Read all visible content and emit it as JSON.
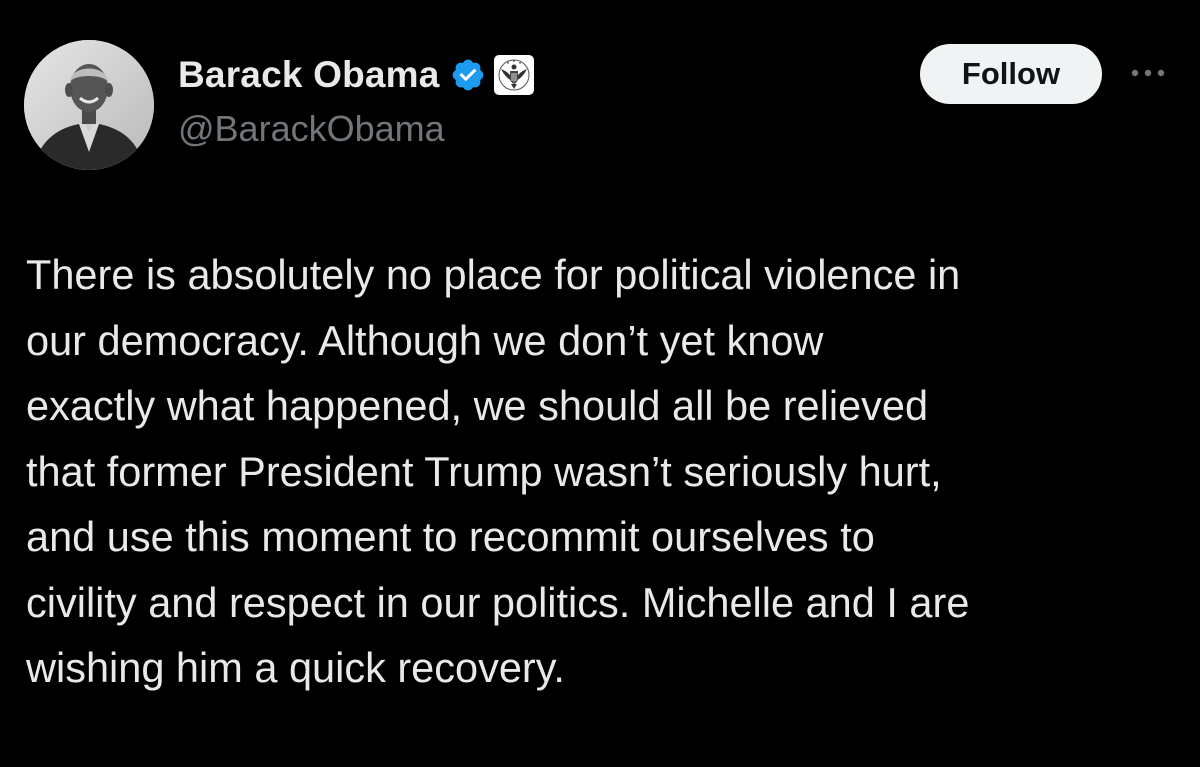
{
  "author": {
    "display_name": "Barack Obama",
    "handle": "@BarackObama",
    "verified_icon": "verified-badge-icon",
    "affiliation_icon": "government-seal-icon",
    "avatar": "profile-photo"
  },
  "actions": {
    "follow_label": "Follow",
    "more_icon": "more-options-icon"
  },
  "tweet": {
    "lines": [
      "There is absolutely no place for political violence in",
      "our democracy. Although we don’t yet know",
      "exactly what happened, we should all be relieved",
      "that former President Trump wasn’t seriously hurt,",
      "and use this moment to recommit ourselves to",
      "civility and respect in our politics. Michelle and I are",
      "wishing him a quick recovery."
    ]
  },
  "colors": {
    "background": "#000000",
    "text_primary": "#e7e9ea",
    "text_secondary": "#71767b",
    "verified_blue": "#1d9bf0",
    "follow_bg": "#eff3f4"
  }
}
